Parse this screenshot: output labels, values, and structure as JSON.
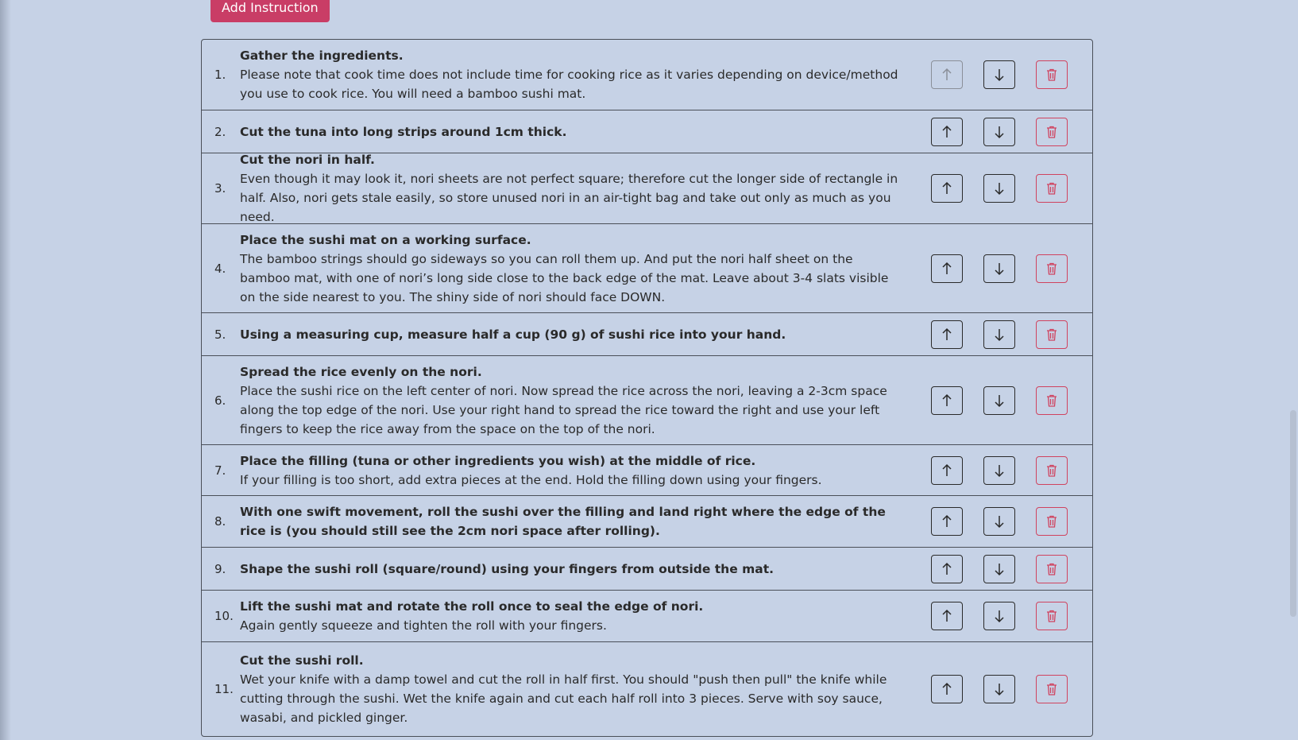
{
  "add_button_label": "Add Instruction",
  "icons": {
    "up": "arrow-up-icon",
    "down": "arrow-down-icon",
    "delete": "trash-icon"
  },
  "colors": {
    "background": "#c6d2e6",
    "accent": "#c93d66",
    "delete": "#d0435f"
  },
  "steps": [
    {
      "num": "1.",
      "title": "Gather the ingredients.",
      "body": "Please note that cook time does not include time for cooking rice as it varies depending on device/method you use to cook rice. You will need a bamboo sushi mat.",
      "up_disabled": true
    },
    {
      "num": "2.",
      "title": "Cut the tuna into long strips around 1cm thick.",
      "body": ""
    },
    {
      "num": "3.",
      "title": "Cut the nori in half.",
      "body": "Even though it may look it, nori sheets are not perfect square; therefore cut the longer side of rectangle in half. Also, nori gets stale easily, so store unused nori in an air-tight bag and take out only as much as you need."
    },
    {
      "num": "4.",
      "title": "Place the sushi mat on a working surface.",
      "body": "The bamboo strings should go sideways so you can roll them up. And put the nori half sheet on the bamboo mat, with one of nori’s long side close to the back edge of the mat. Leave about 3-4 slats visible on the side nearest to you. The shiny side of nori should face DOWN."
    },
    {
      "num": "5.",
      "title": "Using a measuring cup, measure half a cup (90 g) of sushi rice into your hand.",
      "body": ""
    },
    {
      "num": "6.",
      "title": "Spread the rice evenly on the nori.",
      "body": "Place the sushi rice on the left center of nori. Now spread the rice across the nori, leaving a 2-3cm space along the top edge of the nori. Use your right hand to spread the rice toward the right and use your left fingers to keep the rice away from the space on the top of the nori."
    },
    {
      "num": "7.",
      "title": "Place the filling (tuna or other ingredients you wish) at the middle of rice.",
      "body": "If your filling is too short, add extra pieces at the end. Hold the filling down using your fingers."
    },
    {
      "num": "8.",
      "title": "With one swift movement, roll the sushi over the filling and land right where the edge of the rice is (you should still see the 2cm nori space after rolling).",
      "body": ""
    },
    {
      "num": "9.",
      "title": "Shape the sushi roll (square/round) using your fingers from outside the mat.",
      "body": ""
    },
    {
      "num": "10.",
      "title": "Lift the sushi mat and rotate the roll once to seal the edge of nori.",
      "body": "Again gently squeeze and tighten the roll with your fingers."
    },
    {
      "num": "11.",
      "title": "Cut the sushi roll.",
      "body": "Wet your knife with a damp towel and cut the roll in half first. You should \"push then pull\" the knife while cutting through the sushi. Wet the knife again and cut each half roll into 3 pieces. Serve with soy sauce, wasabi, and pickled ginger."
    }
  ]
}
